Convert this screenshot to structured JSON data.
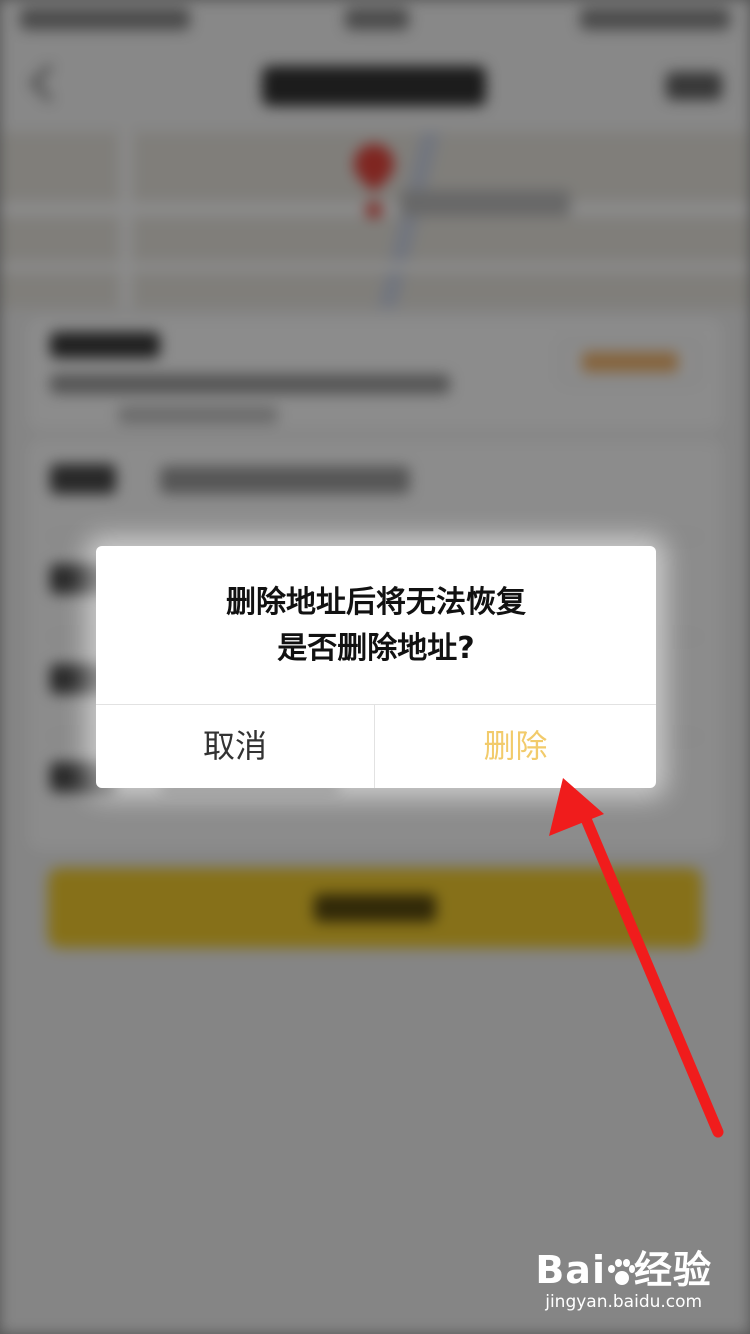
{
  "dialog": {
    "message_line1": "删除地址后将无法恢复",
    "message_line2": "是否删除地址?",
    "cancel_label": "取消",
    "confirm_label": "删除"
  },
  "colors": {
    "confirm_text": "#f2cb6b",
    "cancel_text": "#333333",
    "message_text": "#111111",
    "arrow": "#f01c1c",
    "overlay": "rgba(0,0,0,0.45)",
    "save_button": "#f4cd2e"
  },
  "icons": {
    "back": "chevron-left-icon",
    "map_pin": "map-pin-icon",
    "annotation": "red-arrow-icon"
  },
  "watermark": {
    "logo_text_left": "Bai",
    "logo_text_right": "经验",
    "url": "jingyan.baidu.com"
  }
}
